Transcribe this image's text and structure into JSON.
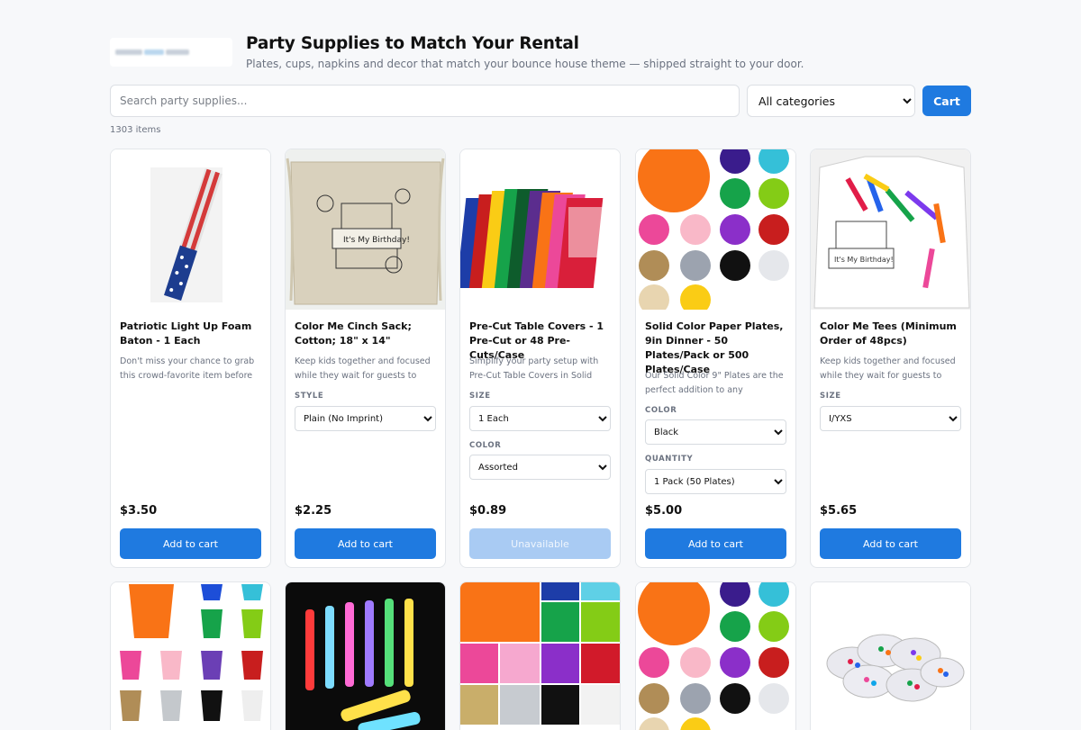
{
  "header": {
    "title": "Party Supplies to Match Your Rental",
    "subtitle": "Plates, cups, napkins and decor that match your bounce house theme — shipped straight to your door."
  },
  "toolbar": {
    "search_placeholder": "Search party supplies...",
    "category_selected": "All categories",
    "cart_label": "Cart"
  },
  "item_count": "1303 items",
  "products": [
    {
      "name": "Patriotic Light Up Foam Baton - 1 Each",
      "desc": "Don't miss your chance to grab this crowd-favorite item before it's gone!",
      "price": "$3.50",
      "button": "Add to cart",
      "image": "foam-baton-image"
    },
    {
      "name": "Color Me Cinch Sack; Cotton; 18\" x 14\"",
      "desc": "Keep kids together and focused while they wait for guests to arrive.",
      "options": [
        {
          "label": "STYLE",
          "value": "Plain (No Imprint)"
        }
      ],
      "price": "$2.25",
      "button": "Add to cart",
      "image": "cinch-sack-image"
    },
    {
      "name": "Pre-Cut Table Covers - 1 Pre-Cut or 48 Pre-Cuts/Case",
      "desc": "Simplify your party setup with Pre-Cut Table Covers in Solid Colors.",
      "options": [
        {
          "label": "SIZE",
          "value": "1 Each"
        },
        {
          "label": "COLOR",
          "value": "Assorted"
        }
      ],
      "price": "$0.89",
      "button": "Unavailable",
      "image": "table-covers-image"
    },
    {
      "name": "Solid Color Paper Plates, 9in Dinner - 50 Plates/Pack or 500 Plates/Case",
      "desc": "Our Solid Color 9\" Plates are the perfect addition to any celebration.",
      "options": [
        {
          "label": "COLOR",
          "value": "Black"
        },
        {
          "label": "QUANTITY",
          "value": "1 Pack (50 Plates)"
        }
      ],
      "price": "$5.00",
      "button": "Add to cart",
      "image": "paper-plates-image"
    },
    {
      "name": "Color Me Tees (Minimum Order of 48pcs)",
      "desc": "Keep kids together and focused while they wait for guests to arrive.",
      "options": [
        {
          "label": "SIZE",
          "value": "I/YXS"
        }
      ],
      "price": "$5.65",
      "button": "Add to cart",
      "image": "color-me-tees-image"
    }
  ],
  "second_row_images": [
    "paper-cups-image",
    "glow-sticks-image",
    "napkins-image",
    "paper-plates-image",
    "party-bowls-image"
  ],
  "colors": {
    "accent": "#1f7ae0",
    "accent_disabled": "#a9cbf3",
    "swatches": [
      "#f97316",
      "#3a1c8c",
      "#35c0d8",
      "#16a34a",
      "#84cc16",
      "#ec4899",
      "#f9b8c8",
      "#8b2fc9",
      "#c81e1e",
      "#b08d57",
      "#9ca3af",
      "#111111",
      "#e5e7eb",
      "#e8d5b0",
      "#facc15",
      "#ffffff"
    ]
  }
}
